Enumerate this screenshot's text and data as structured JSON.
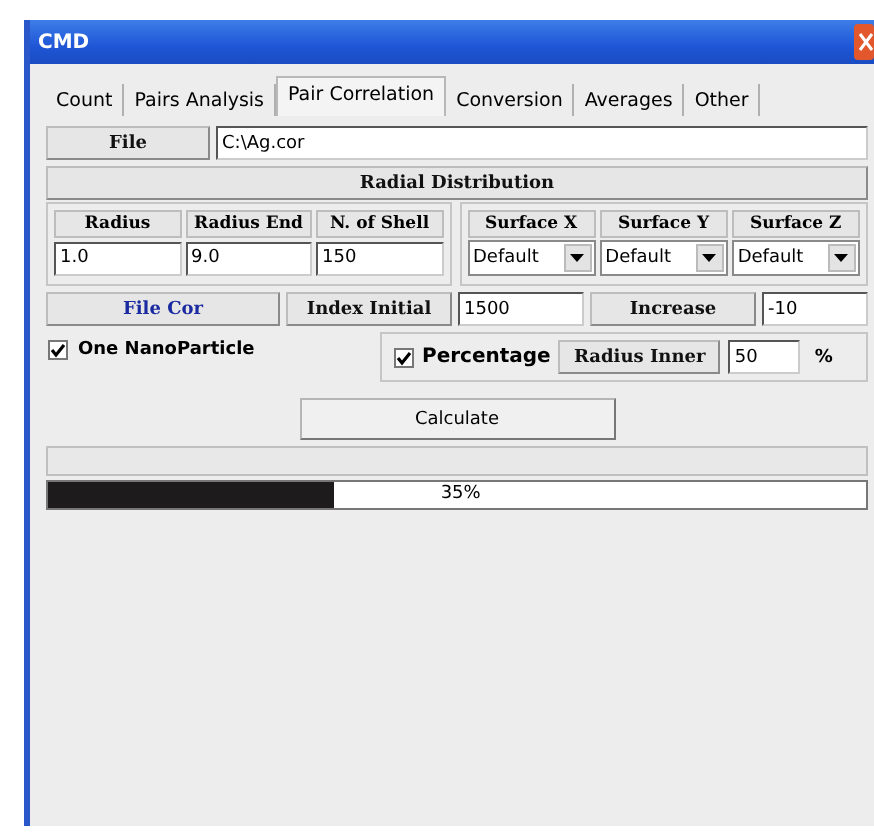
{
  "window": {
    "title": "CMD"
  },
  "tabs": [
    {
      "label": "Count",
      "selected": false
    },
    {
      "label": "Pairs Analysis",
      "selected": false
    },
    {
      "label": "Pair Correlation",
      "selected": true
    },
    {
      "label": "Conversion",
      "selected": false
    },
    {
      "label": "Averages",
      "selected": false
    },
    {
      "label": "Other",
      "selected": false
    }
  ],
  "file": {
    "label": "File",
    "value": "C:\\Ag.cor"
  },
  "section": {
    "title": "Radial Distribution"
  },
  "radius_fields": [
    {
      "label": "Radius",
      "value": "1.0"
    },
    {
      "label": "Radius End",
      "value": "9.0"
    },
    {
      "label": "N. of Shell",
      "value": "150"
    }
  ],
  "surface_selects": [
    {
      "label": "Surface X",
      "value": "Default"
    },
    {
      "label": "Surface Y",
      "value": "Default"
    },
    {
      "label": "Surface Z",
      "value": "Default"
    }
  ],
  "file_cor": {
    "label": "File Cor"
  },
  "index_initial": {
    "label": "Index Initial",
    "value": "1500"
  },
  "increase": {
    "label": "Increase",
    "value": "-10"
  },
  "one_nanoparticle": {
    "label": "One NanoParticle",
    "checked": true
  },
  "percentage": {
    "label": "Percentage",
    "checked": true
  },
  "radius_inner": {
    "label": "Radius Inner",
    "value": "50",
    "unit": "%"
  },
  "calculate_button": "Calculate",
  "progress": {
    "level": 0.35,
    "reading": "35%"
  }
}
